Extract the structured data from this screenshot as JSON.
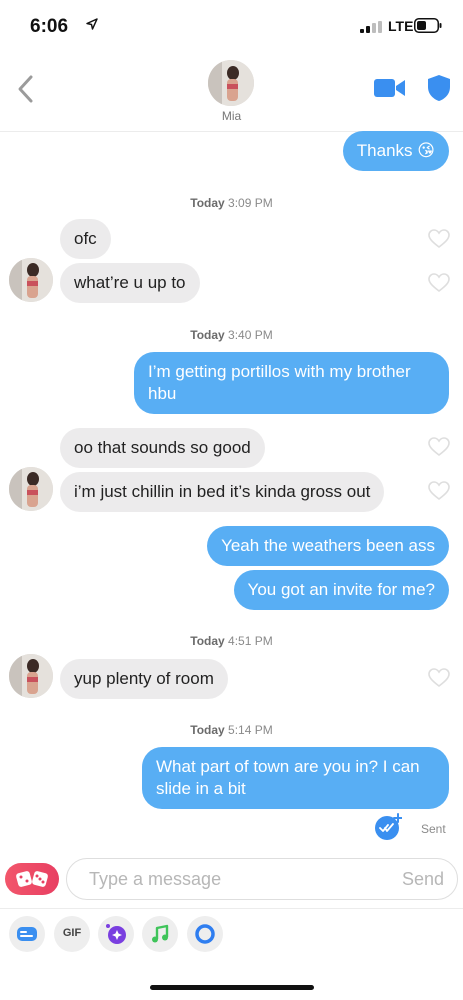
{
  "status_bar": {
    "time": "6:06",
    "network": "LTE"
  },
  "header": {
    "contact_name": "Mia"
  },
  "messages": [
    {
      "side": "sent",
      "text": "Thanks 😘"
    },
    {
      "kind": "timestamp",
      "day": "Today",
      "time": "3:09 PM"
    },
    {
      "side": "received",
      "text": "ofc"
    },
    {
      "side": "received",
      "text": "what’re u up to"
    },
    {
      "kind": "timestamp",
      "day": "Today",
      "time": "3:40 PM"
    },
    {
      "side": "sent",
      "text": "I’m getting portillos with my brother hbu"
    },
    {
      "side": "received",
      "text": "oo that sounds so good"
    },
    {
      "side": "received",
      "text": "i’m just chillin in bed it’s kinda gross out"
    },
    {
      "side": "sent",
      "text": "Yeah the weathers been ass"
    },
    {
      "side": "sent",
      "text": "You got an invite for me?"
    },
    {
      "kind": "timestamp",
      "day": "Today",
      "time": "4:51 PM"
    },
    {
      "side": "received",
      "text": "yup plenty of room"
    },
    {
      "kind": "timestamp",
      "day": "Today",
      "time": "5:14 PM"
    },
    {
      "side": "sent",
      "text": "What part of town are you in? I can slide in a bit"
    }
  ],
  "delivery_status": "Sent",
  "composer": {
    "placeholder": "Type a message",
    "send_label": "Send"
  },
  "toolbar": {
    "gif_label": "GIF"
  },
  "icons": [
    "back-chevron-icon",
    "video-call-icon",
    "shield-icon",
    "heart-icon",
    "double-check-icon",
    "dice-icon",
    "sticker-icon",
    "gif-icon",
    "sparkle-icon",
    "music-icon",
    "circle-icon"
  ],
  "colors": {
    "accent_blue": "#58aef4",
    "received_bubble": "#ecebec",
    "brand_red": "#e83f62",
    "icon_blue": "#3a8ff0"
  }
}
